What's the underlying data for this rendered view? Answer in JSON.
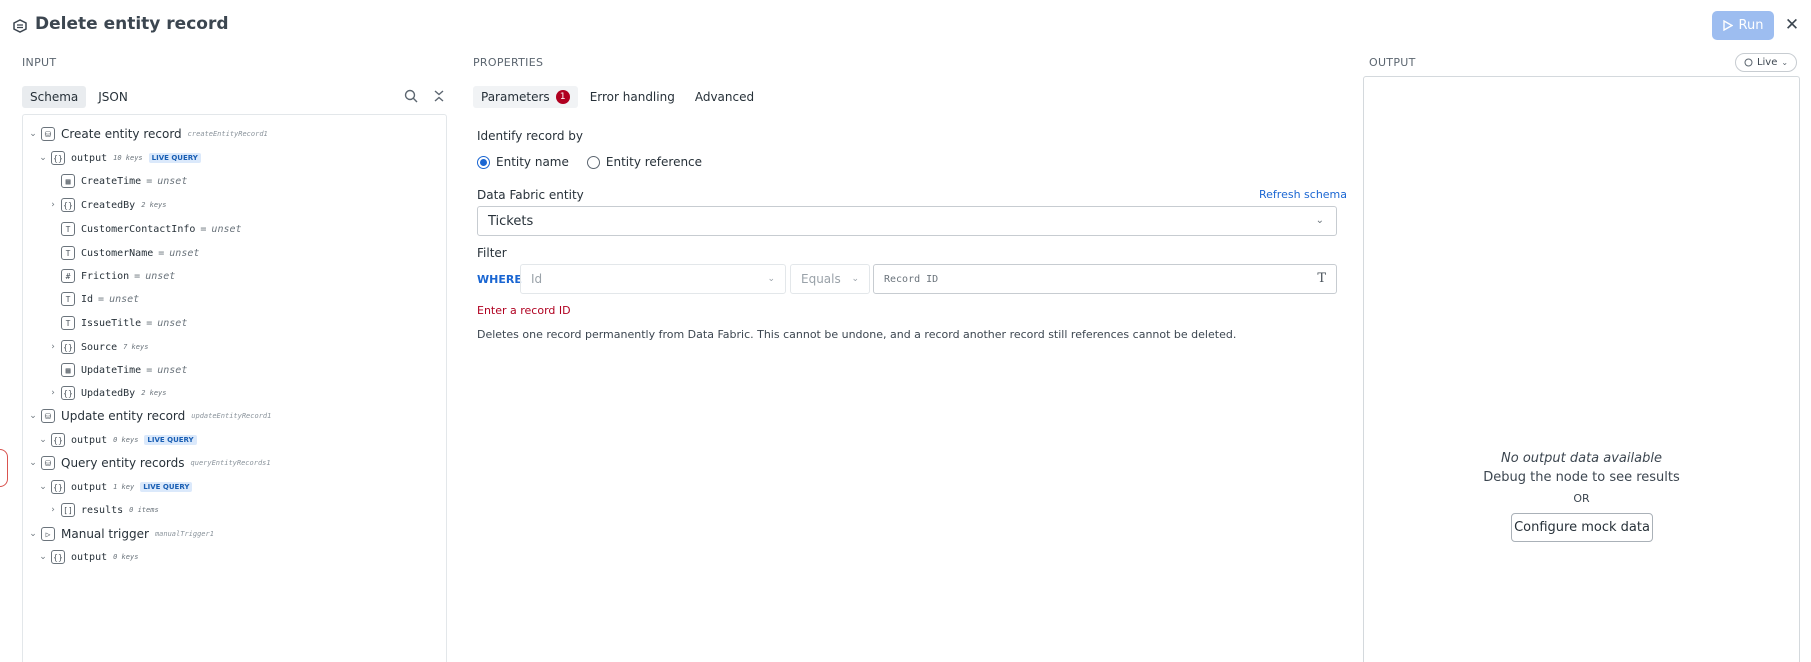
{
  "header": {
    "title": "Delete entity record",
    "run_label": "Run",
    "close_label": "✕"
  },
  "input_panel": {
    "label": "INPUT",
    "tabs": [
      "Schema",
      "JSON"
    ],
    "tree": {
      "create_node": {
        "name": "Create entity record",
        "id": "createEntityRecord1"
      },
      "create_output": {
        "name": "output",
        "keys": "10 keys",
        "badge": "LIVE QUERY"
      },
      "fields": [
        {
          "name": "CreateTime",
          "value": "unset"
        },
        {
          "name": "CreatedBy",
          "keys": "2 keys"
        },
        {
          "name": "CustomerContactInfo",
          "value": "unset"
        },
        {
          "name": "CustomerName",
          "value": "unset"
        },
        {
          "name": "Friction",
          "value": "unset"
        },
        {
          "name": "Id",
          "value": "unset"
        },
        {
          "name": "IssueTitle",
          "value": "unset"
        },
        {
          "name": "Source",
          "keys": "7 keys"
        },
        {
          "name": "UpdateTime",
          "value": "unset"
        },
        {
          "name": "UpdatedBy",
          "keys": "2 keys"
        }
      ],
      "eq": "=",
      "update_node": {
        "name": "Update entity record",
        "id": "updateEntityRecord1"
      },
      "update_output": {
        "name": "output",
        "keys": "0 keys",
        "badge": "LIVE QUERY"
      },
      "query_node": {
        "name": "Query entity records",
        "id": "queryEntityRecords1"
      },
      "query_output": {
        "name": "output",
        "keys": "1 key",
        "badge": "LIVE QUERY"
      },
      "query_results": {
        "name": "results",
        "keys": "0 items"
      },
      "manual_node": {
        "name": "Manual trigger",
        "id": "manualTrigger1"
      },
      "manual_output": {
        "name": "output",
        "keys": "0 keys"
      }
    }
  },
  "properties_panel": {
    "label": "PROPERTIES",
    "tabs": {
      "parameters": "Parameters",
      "parameters_count": "1",
      "error_handling": "Error handling",
      "advanced": "Advanced"
    },
    "identify_label": "Identify record by",
    "radio_entity_name": "Entity name",
    "radio_entity_reference": "Entity reference",
    "entity_label": "Data Fabric entity",
    "refresh_label": "Refresh schema",
    "entity_value": "Tickets",
    "filter_label": "Filter",
    "where_label": "WHERE",
    "field_placeholder": "Id",
    "operator_placeholder": "Equals",
    "record_placeholder": "Record ID",
    "error_text": "Enter a record ID",
    "help_text": "Deletes one record permanently from Data Fabric. This cannot be undone, and a record another record still references cannot be deleted."
  },
  "output_panel": {
    "label": "OUTPUT",
    "live_label": "Live",
    "empty_title": "No output data available",
    "empty_subtitle": "Debug the node to see results",
    "or_label": "OR",
    "mock_button": "Configure mock data"
  }
}
